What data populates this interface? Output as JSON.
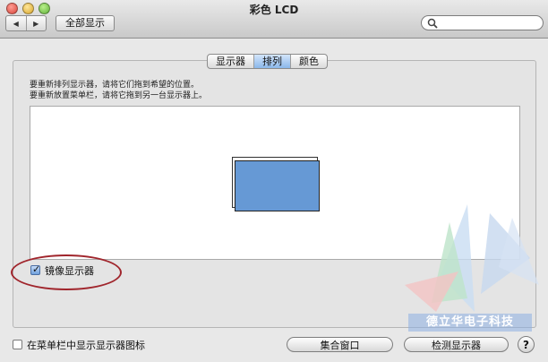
{
  "window": {
    "title": "彩色 LCD"
  },
  "toolbar": {
    "back_icon": "◀",
    "forward_icon": "▶",
    "show_all_label": "全部显示",
    "search_value": ""
  },
  "tabs": [
    {
      "label": "显示器",
      "active": false
    },
    {
      "label": "排列",
      "active": true
    },
    {
      "label": "颜色",
      "active": false
    }
  ],
  "instructions": [
    "要重新排列显示器，请将它们拖到希望的位置。",
    "要重新放置菜单栏，请将它拖到另一台显示器上。"
  ],
  "mirror": {
    "label": "镜像显示器",
    "checked": true
  },
  "footer": {
    "menubar_label": "在菜单栏中显示显示器图标",
    "menubar_checked": false,
    "gather_windows_label": "集合窗口",
    "detect_displays_label": "检测显示器",
    "help_label": "?"
  },
  "watermark": {
    "text": "德立华电子科技"
  }
}
